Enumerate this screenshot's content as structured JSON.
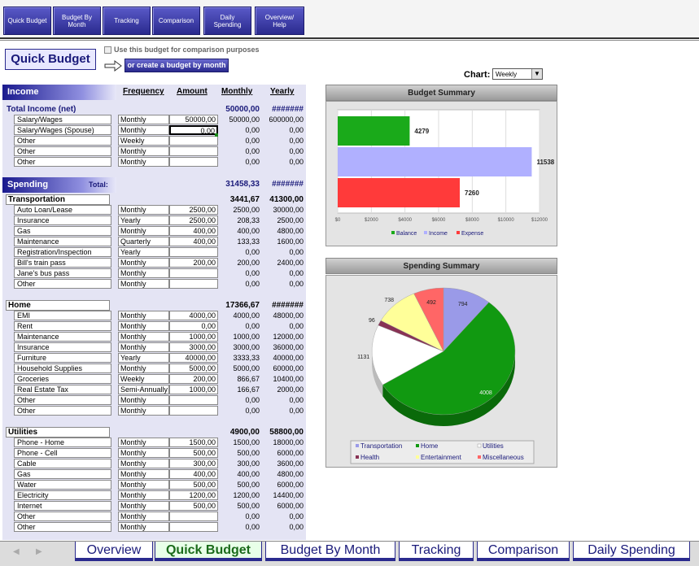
{
  "nav": [
    "Quick Budget",
    "Budget By\nMonth",
    "Tracking",
    "Comparison",
    "Daily\nSpending",
    "Overview/\nHelp"
  ],
  "title": "Quick Budget",
  "compare_label": "Use this budget for comparison purposes",
  "create_label": "or create a budget by month",
  "columns": {
    "freq": "Frequency",
    "amt": "Amount",
    "mon": "Monthly",
    "yr": "Yearly"
  },
  "income": {
    "label": "Income",
    "total_label": "Total Income (net)",
    "total_mon": "50000,00",
    "total_yr": "#######",
    "rows": [
      {
        "name": "Salary/Wages",
        "freq": "Monthly",
        "amt": "50000,00",
        "mon": "50000,00",
        "yr": "600000,00"
      },
      {
        "name": "Salary/Wages (Spouse)",
        "freq": "Monthly",
        "amt": "0,00",
        "mon": "0,00",
        "yr": "0,00"
      },
      {
        "name": "Other",
        "freq": "Weekly",
        "amt": "",
        "mon": "0,00",
        "yr": "0,00"
      },
      {
        "name": "Other",
        "freq": "Monthly",
        "amt": "",
        "mon": "0,00",
        "yr": "0,00"
      },
      {
        "name": "Other",
        "freq": "Monthly",
        "amt": "",
        "mon": "0,00",
        "yr": "0,00"
      }
    ]
  },
  "spending": {
    "label": "Spending",
    "total_label": "Total:",
    "total_mon": "31458,33",
    "total_yr": "#######"
  },
  "transport": {
    "label": "Transportation",
    "mon": "3441,67",
    "yr": "41300,00",
    "rows": [
      {
        "name": "Auto Loan/Lease",
        "freq": "Monthly",
        "amt": "2500,00",
        "mon": "2500,00",
        "yr": "30000,00"
      },
      {
        "name": "Insurance",
        "freq": "Yearly",
        "amt": "2500,00",
        "mon": "208,33",
        "yr": "2500,00"
      },
      {
        "name": "Gas",
        "freq": "Monthly",
        "amt": "400,00",
        "mon": "400,00",
        "yr": "4800,00"
      },
      {
        "name": "Maintenance",
        "freq": "Quarterly",
        "amt": "400,00",
        "mon": "133,33",
        "yr": "1600,00"
      },
      {
        "name": "Registration/Inspection",
        "freq": "Yearly",
        "amt": "",
        "mon": "0,00",
        "yr": "0,00"
      },
      {
        "name": "Bill's train pass",
        "freq": "Monthly",
        "amt": "200,00",
        "mon": "200,00",
        "yr": "2400,00"
      },
      {
        "name": "Jane's bus pass",
        "freq": "Monthly",
        "amt": "",
        "mon": "0,00",
        "yr": "0,00"
      },
      {
        "name": "Other",
        "freq": "Monthly",
        "amt": "",
        "mon": "0,00",
        "yr": "0,00"
      }
    ]
  },
  "home": {
    "label": "Home",
    "mon": "17366,67",
    "yr": "#######",
    "rows": [
      {
        "name": "EMI",
        "freq": "Monthly",
        "amt": "4000,00",
        "mon": "4000,00",
        "yr": "48000,00"
      },
      {
        "name": "Rent",
        "freq": "Monthly",
        "amt": "0,00",
        "mon": "0,00",
        "yr": "0,00"
      },
      {
        "name": "Maintenance",
        "freq": "Monthly",
        "amt": "1000,00",
        "mon": "1000,00",
        "yr": "12000,00"
      },
      {
        "name": "Insurance",
        "freq": "Monthly",
        "amt": "3000,00",
        "mon": "3000,00",
        "yr": "36000,00"
      },
      {
        "name": "Furniture",
        "freq": "Yearly",
        "amt": "40000,00",
        "mon": "3333,33",
        "yr": "40000,00"
      },
      {
        "name": "Household Supplies",
        "freq": "Monthly",
        "amt": "5000,00",
        "mon": "5000,00",
        "yr": "60000,00"
      },
      {
        "name": "Groceries",
        "freq": "Weekly",
        "amt": "200,00",
        "mon": "866,67",
        "yr": "10400,00"
      },
      {
        "name": "Real Estate Tax",
        "freq": "Semi-Annually",
        "amt": "1000,00",
        "mon": "166,67",
        "yr": "2000,00"
      },
      {
        "name": "Other",
        "freq": "Monthly",
        "amt": "",
        "mon": "0,00",
        "yr": "0,00"
      },
      {
        "name": "Other",
        "freq": "Monthly",
        "amt": "",
        "mon": "0,00",
        "yr": "0,00"
      }
    ]
  },
  "utilities": {
    "label": "Utilities",
    "mon": "4900,00",
    "yr": "58800,00",
    "rows": [
      {
        "name": "Phone - Home",
        "freq": "Monthly",
        "amt": "1500,00",
        "mon": "1500,00",
        "yr": "18000,00"
      },
      {
        "name": "Phone - Cell",
        "freq": "Monthly",
        "amt": "500,00",
        "mon": "500,00",
        "yr": "6000,00"
      },
      {
        "name": "Cable",
        "freq": "Monthly",
        "amt": "300,00",
        "mon": "300,00",
        "yr": "3600,00"
      },
      {
        "name": "Gas",
        "freq": "Monthly",
        "amt": "400,00",
        "mon": "400,00",
        "yr": "4800,00"
      },
      {
        "name": "Water",
        "freq": "Monthly",
        "amt": "500,00",
        "mon": "500,00",
        "yr": "6000,00"
      },
      {
        "name": "Electricity",
        "freq": "Monthly",
        "amt": "1200,00",
        "mon": "1200,00",
        "yr": "14400,00"
      },
      {
        "name": "Internet",
        "freq": "Monthly",
        "amt": "500,00",
        "mon": "500,00",
        "yr": "6000,00"
      },
      {
        "name": "Other",
        "freq": "Monthly",
        "amt": "",
        "mon": "0,00",
        "yr": "0,00"
      },
      {
        "name": "Other",
        "freq": "Monthly",
        "amt": "",
        "mon": "0,00",
        "yr": "0,00"
      }
    ]
  },
  "chart_select": {
    "label": "Chart:",
    "value": "Weekly"
  },
  "chart_data": [
    {
      "type": "bar",
      "orientation": "horizontal",
      "title": "Budget Summary",
      "categories": [
        "Balance",
        "Income",
        "Expense"
      ],
      "values": [
        4279,
        11538,
        7260
      ],
      "colors": [
        "#1aaa1a",
        "#b0b0ff",
        "#ff3a3a"
      ],
      "xlim": [
        0,
        12000
      ],
      "ticks": [
        "$0",
        "$2000",
        "$4000",
        "$6000",
        "$8000",
        "$10000",
        "$12000"
      ],
      "grid": true,
      "legend": "bottom"
    },
    {
      "type": "pie",
      "title": "Spending Summary",
      "categories": [
        "Transportation",
        "Home",
        "Utilities",
        "Health",
        "Entertainment",
        "Miscellaneous"
      ],
      "values": [
        794,
        4008,
        1131,
        96,
        738,
        492
      ],
      "colors": [
        "#9a9ae8",
        "#119911",
        "#ffffff",
        "#883355",
        "#ffff99",
        "#ff6666"
      ],
      "legend": "bottom"
    }
  ],
  "tabs": [
    "Overview",
    "Quick Budget",
    "Budget By Month",
    "Tracking",
    "Comparison",
    "Daily Spending"
  ]
}
